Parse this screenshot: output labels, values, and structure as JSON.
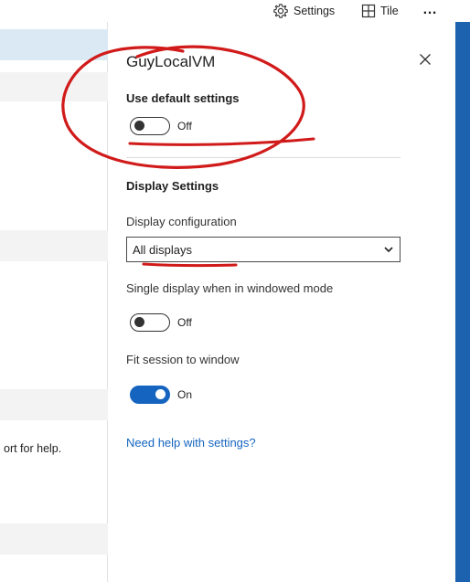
{
  "topbar": {
    "settings_label": "Settings",
    "tile_label": "Tile",
    "more_label": "…"
  },
  "left_panel": {
    "partial_text": "ort for help."
  },
  "pane": {
    "title": "GuyLocalVM",
    "use_default": {
      "label": "Use default settings",
      "state": "Off",
      "on": false
    },
    "display_settings_heading": "Display Settings",
    "display_configuration": {
      "label": "Display configuration",
      "selected": "All displays"
    },
    "single_display": {
      "label": "Single display when in windowed mode",
      "state": "Off",
      "on": false
    },
    "fit_session": {
      "label": "Fit session to window",
      "state": "On",
      "on": true
    },
    "help_link": "Need help with settings?"
  },
  "colors": {
    "accent": "#1565c0",
    "annotation": "#d11a1a",
    "side_strip": "#1d62ae"
  },
  "icons": {
    "settings": "gear-icon",
    "tile": "tile-icon",
    "more": "more-icon",
    "close": "close-icon",
    "dropdown": "chevron-down-icon"
  }
}
